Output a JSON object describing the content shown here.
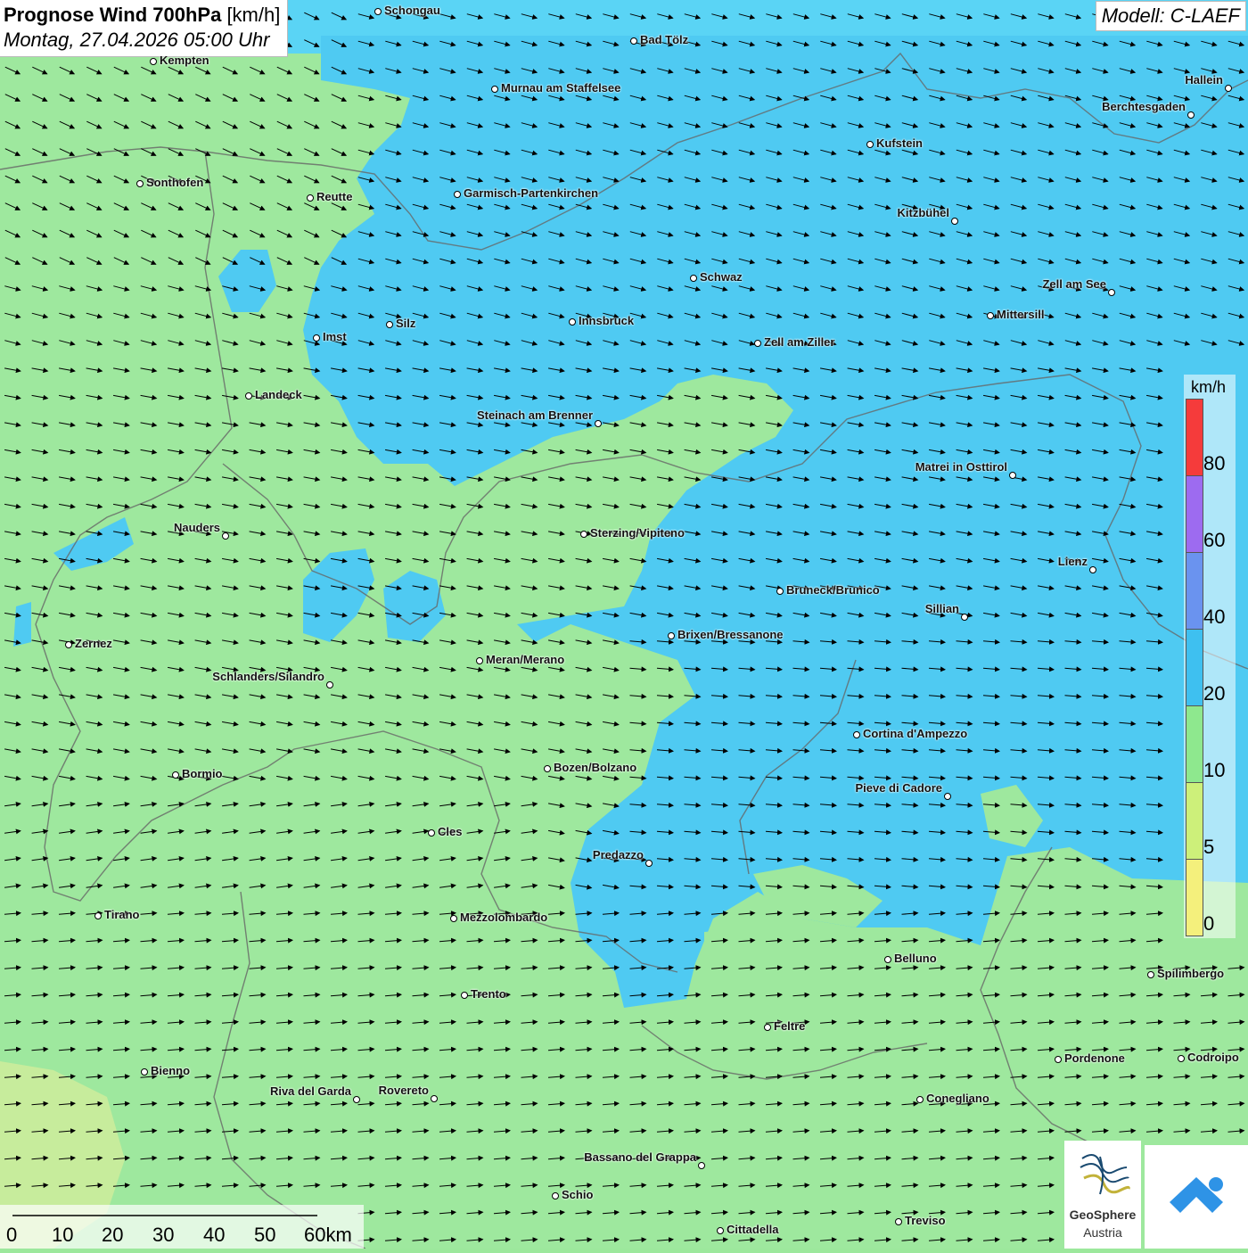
{
  "title": {
    "main_bold": "Prognose Wind 700hPa",
    "unit": "[km/h]",
    "datetime": "Montag, 27.04.2026 05:00 Uhr"
  },
  "model": "Modell: C-LAEF",
  "legend": {
    "unit": "km/h",
    "labels": [
      "80",
      "60",
      "40",
      "20",
      "10",
      "5",
      "0"
    ],
    "colors": [
      "#f53b3b",
      "#9d6bf0",
      "#6a93ef",
      "#3ec0f0",
      "#8ee88e",
      "#cdf07a",
      "#f4f07c"
    ]
  },
  "scale": {
    "labels": [
      "0",
      "10",
      "20",
      "30",
      "40",
      "50",
      "60km"
    ]
  },
  "logos": {
    "geosphere_line1": "GeoSphere",
    "geosphere_line2": "Austria"
  },
  "cities": [
    {
      "name": "Schongau"
    },
    {
      "name": "Bad Tölz"
    },
    {
      "name": "Kempten"
    },
    {
      "name": "Murnau am Staffelsee"
    },
    {
      "name": "Hallein"
    },
    {
      "name": "Berchtesgaden"
    },
    {
      "name": "Kufstein"
    },
    {
      "name": "Sonthofen"
    },
    {
      "name": "Reutte"
    },
    {
      "name": "Garmisch-Partenkirchen"
    },
    {
      "name": "Kitzbühel"
    },
    {
      "name": "Schwaz"
    },
    {
      "name": "Zell am See"
    },
    {
      "name": "Mittersill"
    },
    {
      "name": "Silz"
    },
    {
      "name": "Innsbruck"
    },
    {
      "name": "Imst"
    },
    {
      "name": "Zell am Ziller"
    },
    {
      "name": "Landeck"
    },
    {
      "name": "Steinach am Brenner"
    },
    {
      "name": "Matrei in Osttirol"
    },
    {
      "name": "Nauders"
    },
    {
      "name": "Sterzing/Vipiteno"
    },
    {
      "name": "Lienz"
    },
    {
      "name": "Bruneck/Brunico"
    },
    {
      "name": "Sillian"
    },
    {
      "name": "Brixen/Bressanone"
    },
    {
      "name": "Zernez"
    },
    {
      "name": "Meran/Merano"
    },
    {
      "name": "Schlanders/Silandro"
    },
    {
      "name": "Cortina d'Ampezzo"
    },
    {
      "name": "Bozen/Bolzano"
    },
    {
      "name": "Bormio"
    },
    {
      "name": "Pieve di Cadore"
    },
    {
      "name": "Cles"
    },
    {
      "name": "Predazzo"
    },
    {
      "name": "Tirano"
    },
    {
      "name": "Mezzolombardo"
    },
    {
      "name": "Belluno"
    },
    {
      "name": "Spilimbergo"
    },
    {
      "name": "Trento"
    },
    {
      "name": "Feltre"
    },
    {
      "name": "Pordenone"
    },
    {
      "name": "Codroipo"
    },
    {
      "name": "Bienno"
    },
    {
      "name": "Riva del Garda"
    },
    {
      "name": "Rovereto"
    },
    {
      "name": "Conegliano"
    },
    {
      "name": "Bassano del Grappa"
    },
    {
      "name": "Schio"
    },
    {
      "name": "Treviso"
    },
    {
      "name": "Cittadella"
    }
  ]
}
